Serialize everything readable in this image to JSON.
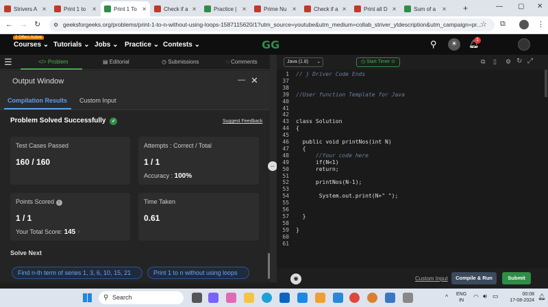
{
  "browser": {
    "tabs": [
      {
        "label": "Strivers A",
        "fav": "tuf"
      },
      {
        "label": "Print 1 to",
        "fav": "tuf"
      },
      {
        "label": "Print 1 To",
        "fav": "gfg",
        "active": true
      },
      {
        "label": "Check if a",
        "fav": "tuf"
      },
      {
        "label": "Practice |",
        "fav": "gfg"
      },
      {
        "label": "Prime Nu",
        "fav": "tuf"
      },
      {
        "label": "Check if a",
        "fav": "tuf"
      },
      {
        "label": "Print all D",
        "fav": "tuf"
      },
      {
        "label": "Sum of a",
        "fav": "gfg"
      }
    ],
    "url": "geeksforgeeks.org/problems/print-1-to-n-without-using-loops-1587115620/1?utm_source=youtube&utm_medium=collab_striver_ytdescription&utm_campaign=pr..."
  },
  "nav": {
    "offer": "2 Offers Active",
    "items": [
      "Courses",
      "Tutorials",
      "Jobs",
      "Practice",
      "Contests"
    ],
    "notif_count": "1"
  },
  "left_tabs": [
    "Problem",
    "Editorial",
    "Submissions",
    "Comments"
  ],
  "output": {
    "title": "Output Window",
    "subtabs": [
      "Compilation Results",
      "Custom Input"
    ],
    "status": "Problem Solved Successfully",
    "feedback": "Suggest Feedback",
    "cards": {
      "tests_label": "Test Cases Passed",
      "tests_value": "160 / 160",
      "attempts_label": "Attempts : Correct / Total",
      "attempts_value": "1 / 1",
      "accuracy_label": "Accuracy :",
      "accuracy_value": "100%",
      "points_label": "Points Scored",
      "points_value": "1 / 1",
      "total_label": "Your Total Score:",
      "total_value": "145",
      "time_label": "Time Taken",
      "time_value": "0.61"
    },
    "solve_next": "Solve Next",
    "suggestions": [
      "Find n-th term of series 1, 3, 6, 10, 15, 21",
      "Print 1 to n without using loops"
    ]
  },
  "editor": {
    "language": "Java (1.8)",
    "timer": "Start Timer",
    "lines": [
      {
        "n": "1",
        "text": "// } Driver Code Ends",
        "cls": "cm"
      },
      {
        "n": "37",
        "text": ""
      },
      {
        "n": "38",
        "text": ""
      },
      {
        "n": "39",
        "text": "//User function Template for Java",
        "cls": "cm"
      },
      {
        "n": "40",
        "text": ""
      },
      {
        "n": "41",
        "text": ""
      },
      {
        "n": "42",
        "text": ""
      },
      {
        "n": "43",
        "text": "class Solution"
      },
      {
        "n": "44",
        "text": "{"
      },
      {
        "n": "45",
        "text": ""
      },
      {
        "n": "46",
        "text": "  public void printNos(int N)"
      },
      {
        "n": "47",
        "text": "  {"
      },
      {
        "n": "48",
        "text": "      //Your code here",
        "cls": "cm"
      },
      {
        "n": "49",
        "text": "      if(N<1)"
      },
      {
        "n": "50",
        "text": "      return;"
      },
      {
        "n": "51",
        "text": ""
      },
      {
        "n": "52",
        "text": "      printNos(N-1);"
      },
      {
        "n": "53",
        "text": ""
      },
      {
        "n": "54",
        "text": "       System.out.print(N+\" \");"
      },
      {
        "n": "55",
        "text": ""
      },
      {
        "n": "56",
        "text": ""
      },
      {
        "n": "57",
        "text": "  }"
      },
      {
        "n": "58",
        "text": ""
      },
      {
        "n": "59",
        "text": "}"
      },
      {
        "n": "60",
        "text": ""
      },
      {
        "n": "61",
        "text": ""
      }
    ],
    "custom_input": "Custom Input",
    "compile": "Compile & Run",
    "submit": "Submit"
  },
  "taskbar": {
    "search": "Search",
    "lang_line1": "ENG",
    "lang_line2": "IN",
    "time": "00:08",
    "date": "17-08-2024"
  },
  "colors": {
    "accent_green": "#2f8d46",
    "link_blue": "#6da5ef",
    "gfg_dark": "#0f0f0f"
  }
}
